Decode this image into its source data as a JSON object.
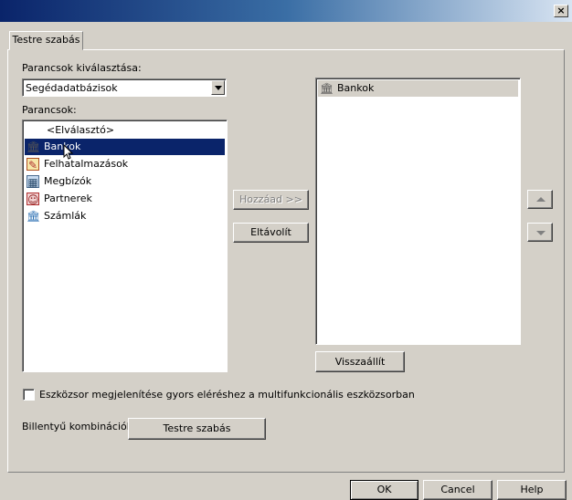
{
  "window": {
    "close_symbol": "×"
  },
  "tab": {
    "label": "Testre szabás"
  },
  "commands_selection": {
    "label": "Parancsok kiválasztása:",
    "selected": "Segédadatbázisok"
  },
  "commands": {
    "label": "Parancsok:",
    "items": [
      {
        "label": "<Elválasztó>",
        "icon": ""
      },
      {
        "label": "Bankok",
        "icon": "bank-icon"
      },
      {
        "label": "Felhatalmazások",
        "icon": "authorization-icon"
      },
      {
        "label": "Megbízók",
        "icon": "client-icon"
      },
      {
        "label": "Partnerek",
        "icon": "partner-card-icon"
      },
      {
        "label": "Számlák",
        "icon": "invoice-bank-icon"
      }
    ]
  },
  "actions": {
    "add": "Hozzáad >>",
    "remove": "Eltávolít",
    "reset": "Visszaállít"
  },
  "toolbar_list": {
    "items": [
      {
        "label": "Bankok",
        "icon": "bank-icon"
      }
    ]
  },
  "quick_access": {
    "label": "Eszközsor megjelenítése gyors eléréshez a multifunkcionális eszközsorban",
    "checked": false
  },
  "shortcuts": {
    "label": "Billentyű kombinációk:",
    "button": "Testre szabás"
  },
  "footer": {
    "ok": "OK",
    "cancel": "Cancel",
    "help": "Help"
  }
}
